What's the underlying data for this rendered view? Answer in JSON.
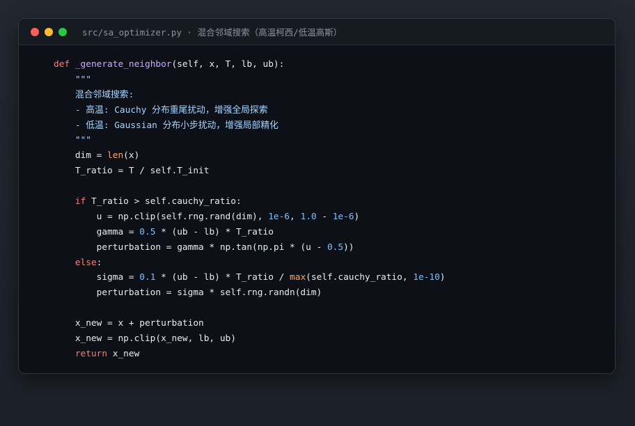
{
  "window": {
    "title": "src/sa_optimizer.py · 混合邻域搜索（高温柯西/低温高斯）",
    "controls": [
      "close",
      "minimize",
      "maximize"
    ]
  },
  "colors": {
    "keyword": "#ff7b72",
    "function": "#d2a8ff",
    "builtin": "#ffa657",
    "number": "#79c0ff",
    "string": "#a5d6ff",
    "text": "#e6edf3",
    "background": "#0d1117"
  },
  "code": {
    "lines": [
      [
        {
          "t": "def ",
          "c": "kw"
        },
        {
          "t": "_generate_neighbor",
          "c": "fn"
        },
        {
          "t": "(self, x, T, lb, ub):",
          "c": "txt"
        }
      ],
      [
        {
          "t": "    \"\"\"",
          "c": "str"
        }
      ],
      [
        {
          "t": "    混合邻域搜索:",
          "c": "str"
        }
      ],
      [
        {
          "t": "    - 高温: Cauchy 分布重尾扰动，增强全局探索",
          "c": "str"
        }
      ],
      [
        {
          "t": "    - 低温: Gaussian 分布小步扰动，增强局部精化",
          "c": "str"
        }
      ],
      [
        {
          "t": "    \"\"\"",
          "c": "str"
        }
      ],
      [
        {
          "t": "    dim = ",
          "c": "txt"
        },
        {
          "t": "len",
          "c": "bi"
        },
        {
          "t": "(x)",
          "c": "txt"
        }
      ],
      [
        {
          "t": "    T_ratio = T / self.T_init",
          "c": "txt"
        }
      ],
      [],
      [
        {
          "t": "    ",
          "c": "txt"
        },
        {
          "t": "if",
          "c": "kw"
        },
        {
          "t": " T_ratio > self.cauchy_ratio:",
          "c": "txt"
        }
      ],
      [
        {
          "t": "        u = np.clip(self.rng.rand(dim), ",
          "c": "txt"
        },
        {
          "t": "1e-6",
          "c": "num"
        },
        {
          "t": ", ",
          "c": "txt"
        },
        {
          "t": "1.0",
          "c": "num"
        },
        {
          "t": " - ",
          "c": "txt"
        },
        {
          "t": "1e-6",
          "c": "num"
        },
        {
          "t": ")",
          "c": "txt"
        }
      ],
      [
        {
          "t": "        gamma = ",
          "c": "txt"
        },
        {
          "t": "0.5",
          "c": "num"
        },
        {
          "t": " * (ub - lb) * T_ratio",
          "c": "txt"
        }
      ],
      [
        {
          "t": "        perturbation = gamma * np.tan(np.pi * (u - ",
          "c": "txt"
        },
        {
          "t": "0.5",
          "c": "num"
        },
        {
          "t": "))",
          "c": "txt"
        }
      ],
      [
        {
          "t": "    ",
          "c": "txt"
        },
        {
          "t": "else",
          "c": "kw"
        },
        {
          "t": ":",
          "c": "txt"
        }
      ],
      [
        {
          "t": "        sigma = ",
          "c": "txt"
        },
        {
          "t": "0.1",
          "c": "num"
        },
        {
          "t": " * (ub - lb) * T_ratio / ",
          "c": "txt"
        },
        {
          "t": "max",
          "c": "bi"
        },
        {
          "t": "(self.cauchy_ratio, ",
          "c": "txt"
        },
        {
          "t": "1e-10",
          "c": "num"
        },
        {
          "t": ")",
          "c": "txt"
        }
      ],
      [
        {
          "t": "        perturbation = sigma * self.rng.randn(dim)",
          "c": "txt"
        }
      ],
      [],
      [
        {
          "t": "    x_new = x + perturbation",
          "c": "txt"
        }
      ],
      [
        {
          "t": "    x_new = np.clip(x_new, lb, ub)",
          "c": "txt"
        }
      ],
      [
        {
          "t": "    ",
          "c": "txt"
        },
        {
          "t": "return",
          "c": "kw"
        },
        {
          "t": " x_new",
          "c": "txt"
        }
      ]
    ]
  }
}
